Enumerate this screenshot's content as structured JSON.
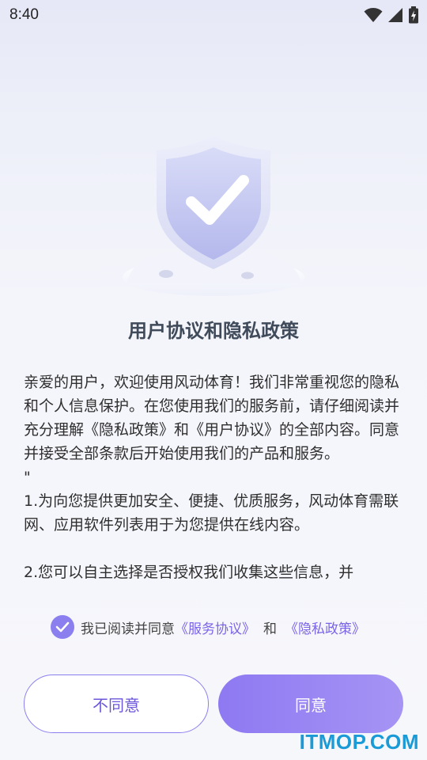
{
  "status_bar": {
    "time": "8:40"
  },
  "dialog": {
    "title": "用户协议和隐私政策",
    "paragraphs": [
      "亲爱的用户，欢迎使用风动体育！我们非常重视您的隐私和个人信息保护。在您使用我们的服务前，请仔细阅读并充分理解《隐私政策》和《用户协议》的全部内容。同意并接受全部条款后开始使用我们的产品和服务。",
      "\"",
      "1.为向您提供更加安全、便捷、优质服务，风动体育需联网、应用软件列表用于为您提供在线内容。",
      "2.您可以自主选择是否授权我们收集这些信息，并"
    ],
    "agree": {
      "checked": true,
      "text": "我已阅读并同意",
      "service_link": "《服务协议》",
      "and_text": "和",
      "privacy_link": "《隐私政策》"
    },
    "buttons": {
      "disagree": "不同意",
      "agree": "同意"
    }
  },
  "watermark": "ITMOP.COM",
  "colors": {
    "accent": "#8b7ff0",
    "link": "#7b64e8",
    "title": "#3f4a5a",
    "watermark": "#1a9ad6"
  },
  "icons": [
    "wifi-icon",
    "signal-icon",
    "battery-icon",
    "shield-check-icon",
    "checkmark-icon"
  ]
}
